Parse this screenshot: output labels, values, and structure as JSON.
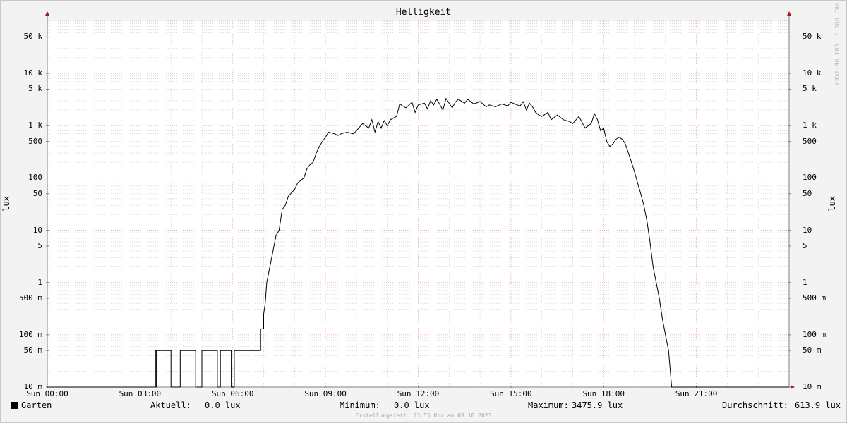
{
  "watermark": "RRDTOOL / TOBI OETIKER",
  "legend": {
    "series_name": "Garten",
    "current_label": "Aktuell:",
    "current_value": "0.0 lux",
    "min_label": "Minimum:",
    "min_value": "0.0 lux",
    "max_label": "Maximum:",
    "max_value": "3475.9 lux",
    "avg_label": "Durchschnitt:",
    "avg_value": "613.9 lux",
    "swatch_color": "#000000"
  },
  "footer": "Erstellungszeit: 23:55 Uhr am 08.10.2023",
  "chart_data": {
    "type": "line",
    "title": "Helligkeit",
    "ylabel": "lux",
    "yscale": "log",
    "ylim": [
      0.01,
      100000
    ],
    "xlim": [
      0,
      24
    ],
    "grid": true,
    "legend_position": "bottom",
    "colors": {
      "line": "#000000",
      "major_grid": "#e9a0a8",
      "minor_grid": "#c8c8c8",
      "axis": "#808080",
      "arrow": "#a02020"
    },
    "y_ticks": [
      {
        "value": 0.01,
        "label": "10 m"
      },
      {
        "value": 0.05,
        "label": "50 m"
      },
      {
        "value": 0.1,
        "label": "100 m"
      },
      {
        "value": 0.5,
        "label": "500 m"
      },
      {
        "value": 1,
        "label": "1"
      },
      {
        "value": 5,
        "label": "5"
      },
      {
        "value": 10,
        "label": "10"
      },
      {
        "value": 50,
        "label": "50"
      },
      {
        "value": 100,
        "label": "100"
      },
      {
        "value": 500,
        "label": "500"
      },
      {
        "value": 1000,
        "label": "1 k"
      },
      {
        "value": 5000,
        "label": "5 k"
      },
      {
        "value": 10000,
        "label": "10 k"
      },
      {
        "value": 50000,
        "label": "50 k"
      }
    ],
    "x_ticks": [
      {
        "value": 0,
        "label": "Sun 00:00"
      },
      {
        "value": 3,
        "label": "Sun 03:00"
      },
      {
        "value": 6,
        "label": "Sun 06:00"
      },
      {
        "value": 9,
        "label": "Sun 09:00"
      },
      {
        "value": 12,
        "label": "Sun 12:00"
      },
      {
        "value": 15,
        "label": "Sun 15:00"
      },
      {
        "value": 18,
        "label": "Sun 18:00"
      },
      {
        "value": 21,
        "label": "Sun 21:00"
      }
    ],
    "series": [
      {
        "name": "Garten",
        "x": [
          0,
          3.5,
          3.5,
          3.53,
          3.53,
          3.55,
          3.55,
          4.0,
          4.0,
          4.3,
          4.3,
          4.8,
          4.8,
          5.0,
          5.0,
          5.5,
          5.5,
          5.6,
          5.6,
          5.95,
          5.95,
          6.05,
          6.05,
          6.2,
          6.2,
          6.4,
          6.4,
          6.6,
          6.6,
          6.9,
          6.9,
          7.0,
          7.0,
          7.05,
          7.1,
          7.2,
          7.4,
          7.5,
          7.6,
          7.7,
          7.8,
          8.0,
          8.1,
          8.2,
          8.3,
          8.4,
          8.5,
          8.6,
          8.7,
          8.8,
          8.9,
          9.0,
          9.1,
          9.3,
          9.4,
          9.5,
          9.7,
          9.9,
          10.0,
          10.2,
          10.4,
          10.5,
          10.6,
          10.7,
          10.8,
          10.9,
          11.0,
          11.1,
          11.2,
          11.3,
          11.4,
          11.6,
          11.8,
          11.9,
          12.0,
          12.2,
          12.3,
          12.4,
          12.5,
          12.6,
          12.8,
          12.9,
          13.1,
          13.2,
          13.3,
          13.5,
          13.6,
          13.8,
          14.0,
          14.2,
          14.3,
          14.5,
          14.7,
          14.9,
          15.0,
          15.2,
          15.3,
          15.4,
          15.5,
          15.6,
          15.7,
          15.8,
          15.9,
          16.0,
          16.2,
          16.3,
          16.5,
          16.7,
          16.9,
          17.0,
          17.2,
          17.4,
          17.6,
          17.7,
          17.8,
          17.9,
          18.0,
          18.1,
          18.2,
          18.3,
          18.4,
          18.5,
          18.6,
          18.7,
          18.8,
          18.9,
          19.0,
          19.1,
          19.2,
          19.3,
          19.4,
          19.5,
          19.6,
          19.7,
          19.8,
          19.9,
          20.0,
          20.1,
          20.2,
          20.3,
          20.35,
          20.4,
          20.45,
          20.5,
          20.55,
          20.6,
          20.6,
          24
        ],
        "y": [
          0.01,
          0.01,
          0.05,
          0.05,
          0.01,
          0.01,
          0.05,
          0.05,
          0.01,
          0.01,
          0.05,
          0.05,
          0.01,
          0.01,
          0.05,
          0.05,
          0.01,
          0.01,
          0.05,
          0.05,
          0.01,
          0.01,
          0.05,
          0.05,
          0.05,
          0.05,
          0.05,
          0.05,
          0.05,
          0.05,
          0.13,
          0.13,
          0.25,
          0.4,
          1.0,
          2.0,
          8.0,
          10.0,
          25.0,
          30.0,
          45.0,
          60.0,
          80.0,
          90.0,
          100.0,
          150.0,
          180.0,
          200.0,
          300.0,
          400.0,
          500.0,
          600.0,
          750.0,
          700.0,
          650.0,
          700.0,
          750.0,
          700.0,
          800.0,
          1100.0,
          900.0,
          1300.0,
          750.0,
          1200.0,
          900.0,
          1250.0,
          1000.0,
          1300.0,
          1400.0,
          1500.0,
          2600.0,
          2200.0,
          2800.0,
          1800.0,
          2500.0,
          2700.0,
          2100.0,
          3000.0,
          2500.0,
          3200.0,
          2000.0,
          3300.0,
          2200.0,
          2800.0,
          3200.0,
          2700.0,
          3200.0,
          2600.0,
          2900.0,
          2300.0,
          2500.0,
          2300.0,
          2600.0,
          2400.0,
          2800.0,
          2500.0,
          2400.0,
          2900.0,
          2000.0,
          2700.0,
          2300.0,
          1800.0,
          1600.0,
          1500.0,
          1800.0,
          1300.0,
          1600.0,
          1300.0,
          1200.0,
          1100.0,
          1500.0,
          900.0,
          1100.0,
          1700.0,
          1300.0,
          800.0,
          900.0,
          500.0,
          400.0,
          450.0,
          550.0,
          600.0,
          550.0,
          450.0,
          300.0,
          200.0,
          130.0,
          80.0,
          50.0,
          30.0,
          15.0,
          6.0,
          2.0,
          1.0,
          0.5,
          0.2,
          0.1,
          0.05,
          0.01,
          0.01,
          0.01,
          0.01,
          0.01,
          0.01,
          0.01,
          0.01,
          0.01,
          0.01
        ]
      }
    ]
  }
}
